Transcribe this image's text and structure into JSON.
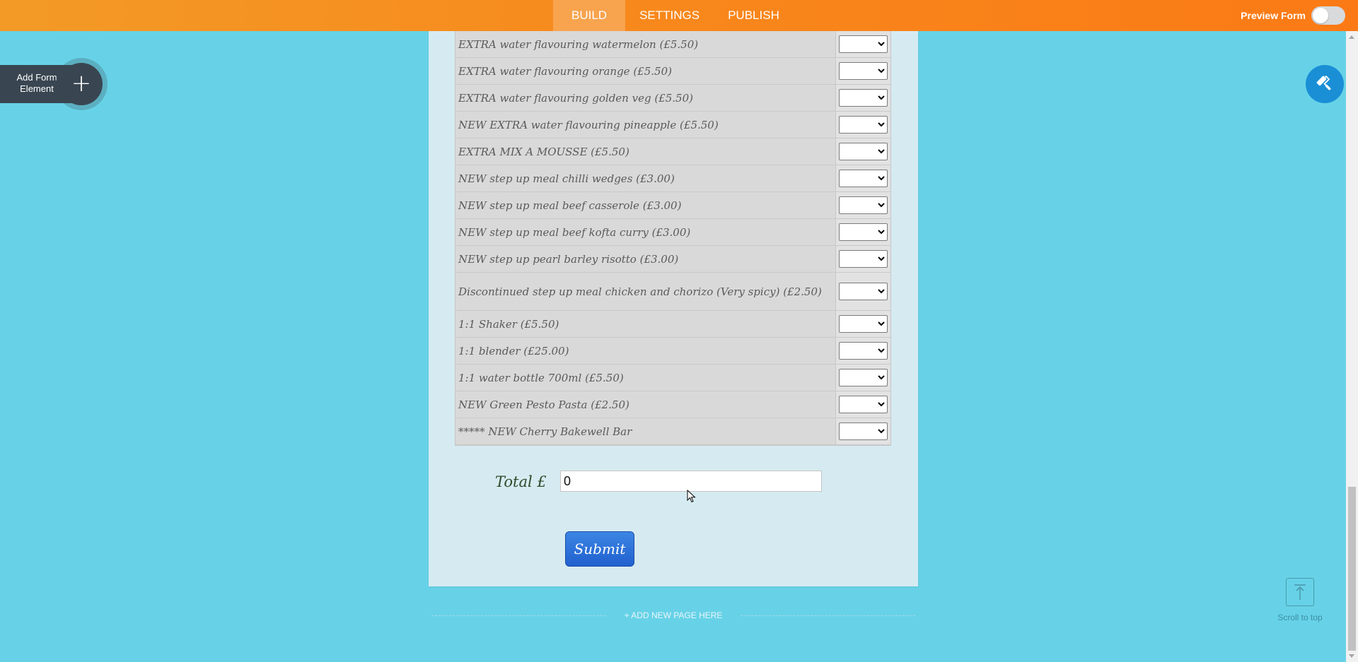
{
  "topbar": {
    "tabs": [
      {
        "label": "BUILD",
        "active": true
      },
      {
        "label": "SETTINGS",
        "active": false
      },
      {
        "label": "PUBLISH",
        "active": false
      }
    ],
    "preview_label": "Preview Form",
    "preview_on": false
  },
  "add_element": {
    "label": "Add Form Element",
    "icon": "plus-icon"
  },
  "designer": {
    "icon": "paint-roller-icon"
  },
  "form": {
    "items": [
      "EXTRA water flavouring watermelon (£5.50)",
      "EXTRA water flavouring orange (£5.50)",
      "EXTRA water flavouring golden veg (£5.50)",
      "NEW EXTRA water flavouring pineapple (£5.50)",
      "EXTRA MIX A MOUSSE (£5.50)",
      "NEW step up meal chilli wedges (£3.00)",
      "NEW step up meal beef casserole (£3.00)",
      "NEW step up meal beef kofta curry (£3.00)",
      "NEW step up pearl barley risotto (£3.00)",
      "Discontinued step up meal chicken and chorizo (Very spicy) (£2.50)",
      "1:1 Shaker (£5.50)",
      "1:1 blender (£25.00)",
      "1:1 water bottle 700ml (£5.50)",
      "NEW Green Pesto Pasta (£2.50)",
      "***** NEW Cherry Bakewell Bar"
    ],
    "total_label": "Total  £",
    "total_value": "0",
    "submit_label": "Submit"
  },
  "new_page_label": "+ ADD NEW PAGE HERE",
  "scroll_top_label": "Scroll to top",
  "colors": {
    "background": "#67d2e7",
    "topbar": "#f8861b",
    "submit": "#2a6fdc",
    "designer": "#1a8fd6"
  }
}
